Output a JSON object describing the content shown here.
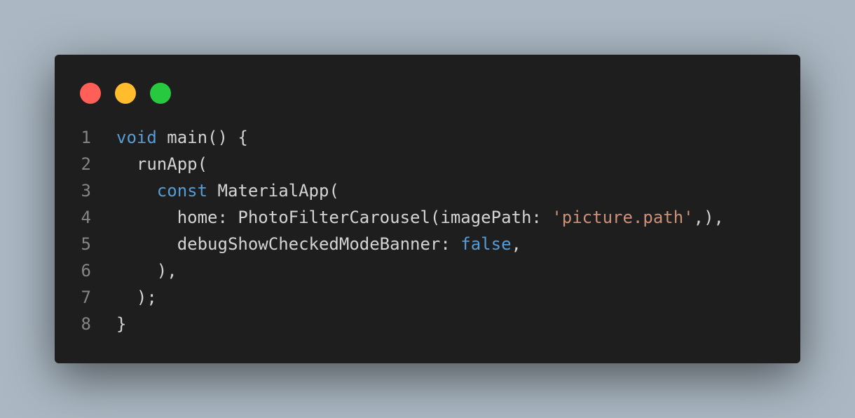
{
  "window": {
    "controls": [
      {
        "name": "close",
        "color": "#ff5f56"
      },
      {
        "name": "minimize",
        "color": "#ffbd2e"
      },
      {
        "name": "maximize",
        "color": "#27c93f"
      }
    ]
  },
  "colors": {
    "background": "#abb8c3",
    "editor": "#1e1e1e",
    "keyword": "#569cd6",
    "string": "#ce9178",
    "plain": "#d4d4d4",
    "line_number": "#858585"
  },
  "code": {
    "lines": [
      {
        "number": "1",
        "tokens": [
          {
            "text": "void",
            "kind": "keyword"
          },
          {
            "text": " main() {",
            "kind": "plain"
          }
        ]
      },
      {
        "number": "2",
        "tokens": [
          {
            "text": "  runApp(",
            "kind": "plain"
          }
        ]
      },
      {
        "number": "3",
        "tokens": [
          {
            "text": "    ",
            "kind": "plain"
          },
          {
            "text": "const",
            "kind": "keyword"
          },
          {
            "text": " MaterialApp(",
            "kind": "plain"
          }
        ]
      },
      {
        "number": "4",
        "tokens": [
          {
            "text": "      home: PhotoFilterCarousel(imagePath: ",
            "kind": "plain"
          },
          {
            "text": "'picture.path'",
            "kind": "string"
          },
          {
            "text": ",),",
            "kind": "plain"
          }
        ]
      },
      {
        "number": "5",
        "tokens": [
          {
            "text": "      debugShowCheckedModeBanner: ",
            "kind": "plain"
          },
          {
            "text": "false",
            "kind": "keyword"
          },
          {
            "text": ",",
            "kind": "plain"
          }
        ]
      },
      {
        "number": "6",
        "tokens": [
          {
            "text": "    ),",
            "kind": "plain"
          }
        ]
      },
      {
        "number": "7",
        "tokens": [
          {
            "text": "  );",
            "kind": "plain"
          }
        ]
      },
      {
        "number": "8",
        "tokens": [
          {
            "text": "}",
            "kind": "plain"
          }
        ]
      }
    ]
  }
}
